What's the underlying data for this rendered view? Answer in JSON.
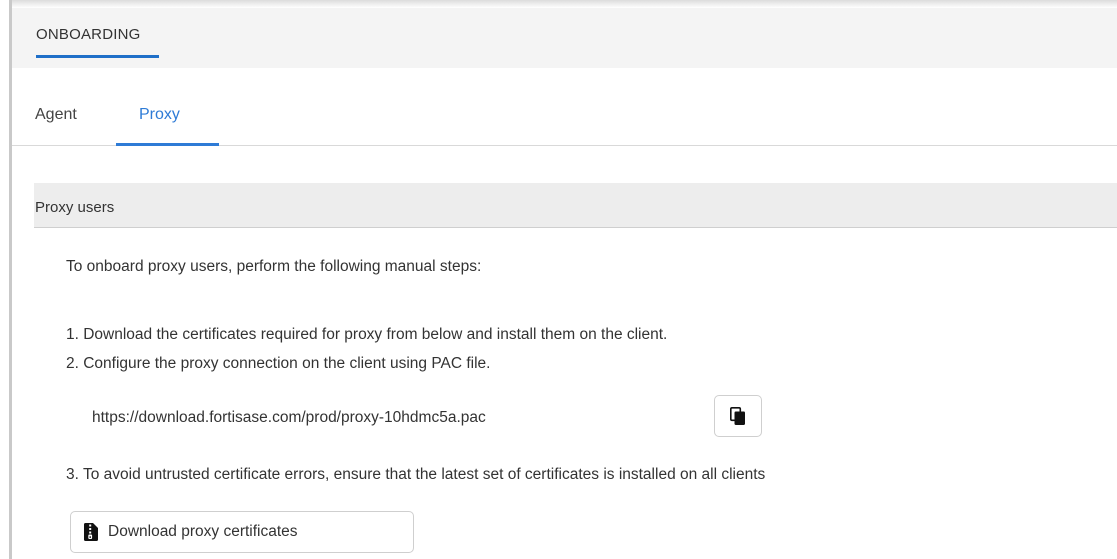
{
  "header": {
    "title": "ONBOARDING"
  },
  "tabs": [
    {
      "label": "Agent",
      "active": false
    },
    {
      "label": "Proxy",
      "active": true
    }
  ],
  "section": {
    "title": "Proxy users"
  },
  "content": {
    "intro": "To onboard proxy users, perform the following manual steps:",
    "step1": "1. Download the certificates required for proxy from below and install them on the client.",
    "step2": "2. Configure the proxy connection on the client using PAC file.",
    "pac_url": "https://download.fortisase.com/prod/proxy-10hdmc5a.pac",
    "step3": "3. To avoid untrusted certificate errors, ensure that the latest set of certificates is installed on all clients"
  },
  "buttons": {
    "copy_icon": "copy-icon",
    "download_label": "Download proxy certificates",
    "download_icon": "file-zip-icon"
  },
  "colors": {
    "accent": "#2e7bd6",
    "header_underline": "#1f6fc8",
    "header_bg": "#f4f4f4",
    "section_bg": "#ededed"
  }
}
